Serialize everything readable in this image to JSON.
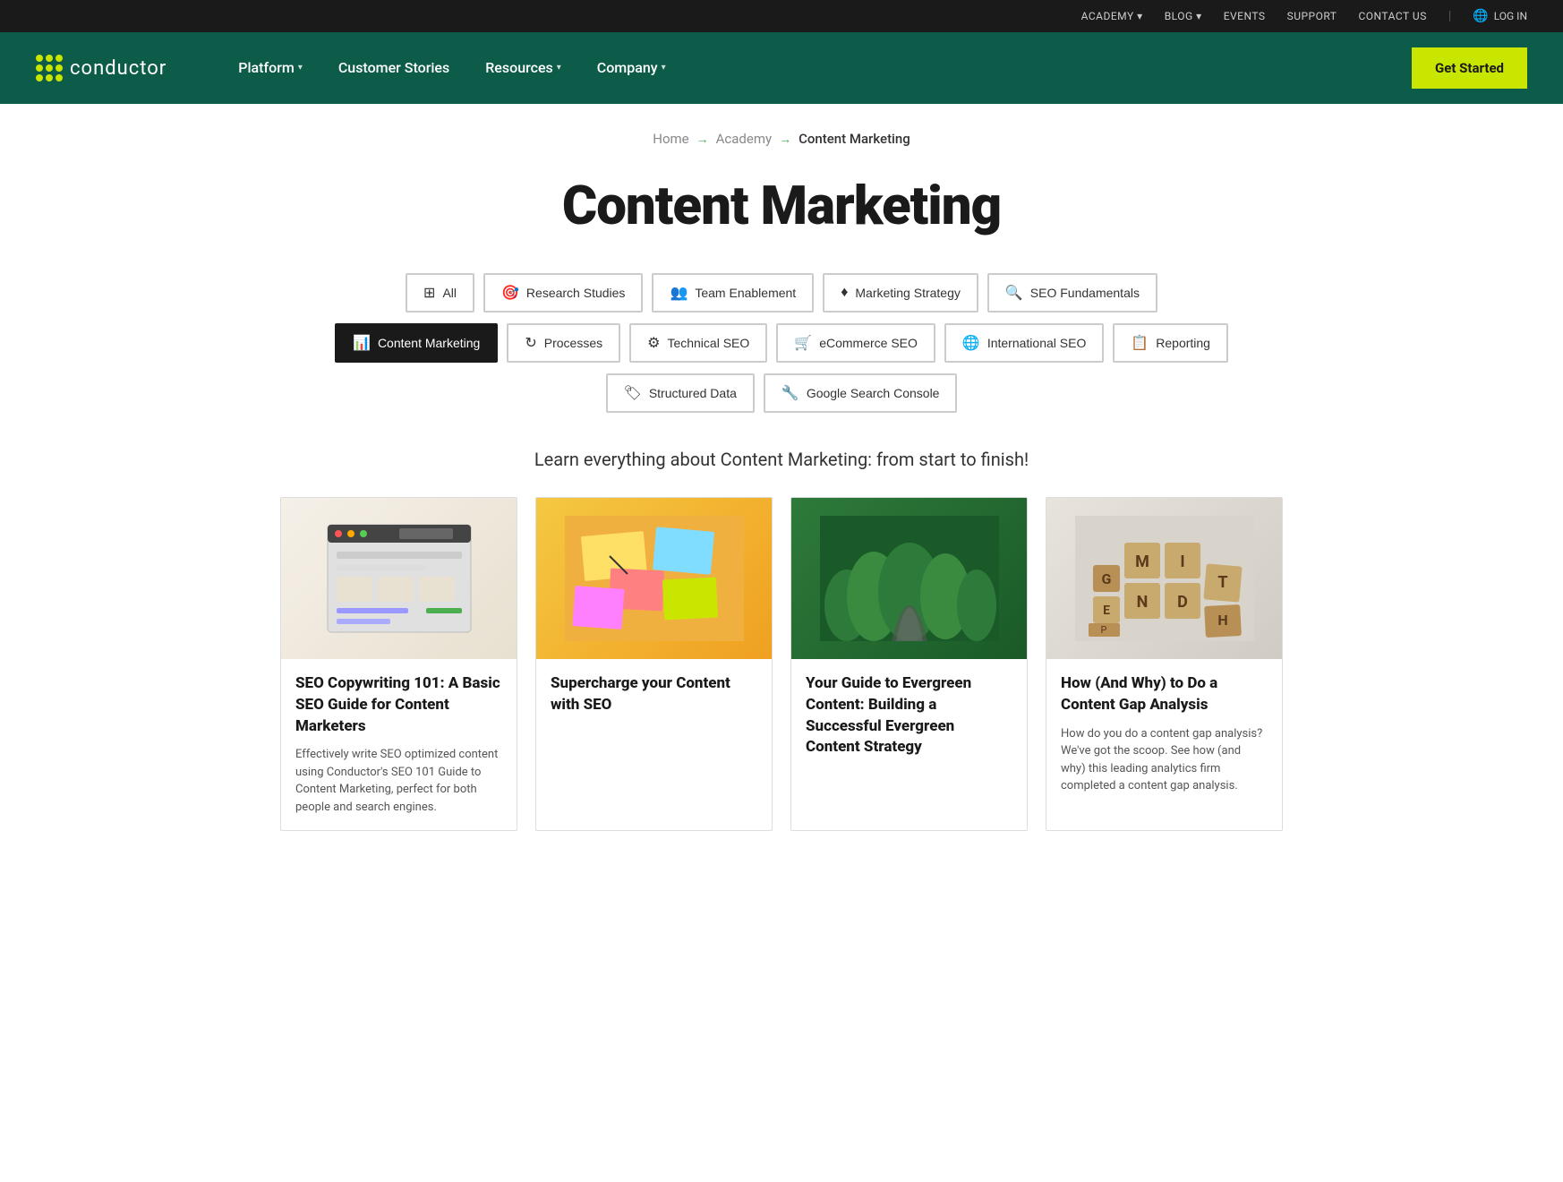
{
  "topbar": {
    "links": [
      "ACADEMY ▾",
      "BLOG ▾",
      "EVENTS",
      "SUPPORT",
      "CONTACT US"
    ],
    "login_label": "LOG IN"
  },
  "nav": {
    "logo_name": "conductor",
    "links": [
      {
        "label": "Platform",
        "has_arrow": true
      },
      {
        "label": "Customer Stories",
        "has_arrow": false
      },
      {
        "label": "Resources",
        "has_arrow": true
      },
      {
        "label": "Company",
        "has_arrow": true
      }
    ],
    "cta_label": "Get Started"
  },
  "breadcrumb": {
    "home": "Home",
    "academy": "Academy",
    "current": "Content Marketing"
  },
  "page": {
    "title": "Content Marketing",
    "subtitle": "Learn everything about Content Marketing: from start to finish!"
  },
  "filters": {
    "row1": [
      {
        "label": "All",
        "icon": "⊞",
        "active": false
      },
      {
        "label": "Research Studies",
        "icon": "🎯",
        "active": false
      },
      {
        "label": "Team Enablement",
        "icon": "👥",
        "active": false
      },
      {
        "label": "Marketing Strategy",
        "icon": "♦",
        "active": false
      },
      {
        "label": "SEO Fundamentals",
        "icon": "🔍",
        "active": false
      }
    ],
    "row2": [
      {
        "label": "Content Marketing",
        "icon": "📊",
        "active": true
      },
      {
        "label": "Processes",
        "icon": "↻",
        "active": false
      },
      {
        "label": "Technical SEO",
        "icon": "⚙",
        "active": false
      },
      {
        "label": "eCommerce SEO",
        "icon": "🛒",
        "active": false
      },
      {
        "label": "International SEO",
        "icon": "🌐",
        "active": false
      },
      {
        "label": "Reporting",
        "icon": "📋",
        "active": false
      }
    ],
    "row3": [
      {
        "label": "Structured Data",
        "icon": "🏷",
        "active": false
      },
      {
        "label": "Google Search Console",
        "icon": "🔧",
        "active": false
      }
    ]
  },
  "cards": [
    {
      "title": "SEO Copywriting 101: A Basic SEO Guide for Content Marketers",
      "description": "Effectively write SEO optimized content using Conductor's SEO 101 Guide to Content Marketing, perfect for both people and search engines.",
      "image_type": "browser-mockup"
    },
    {
      "title": "Supercharge your Content with SEO",
      "description": "",
      "image_type": "sticky-notes"
    },
    {
      "title": "Your Guide to Evergreen Content: Building a Successful Evergreen Content Strategy",
      "description": "",
      "image_type": "aerial-forest"
    },
    {
      "title": "How (And Why) to Do a Content Gap Analysis",
      "description": "How do you do a content gap analysis? We've got the scoop. See how (and why) this leading analytics firm completed a content gap analysis.",
      "image_type": "scrabble"
    }
  ]
}
